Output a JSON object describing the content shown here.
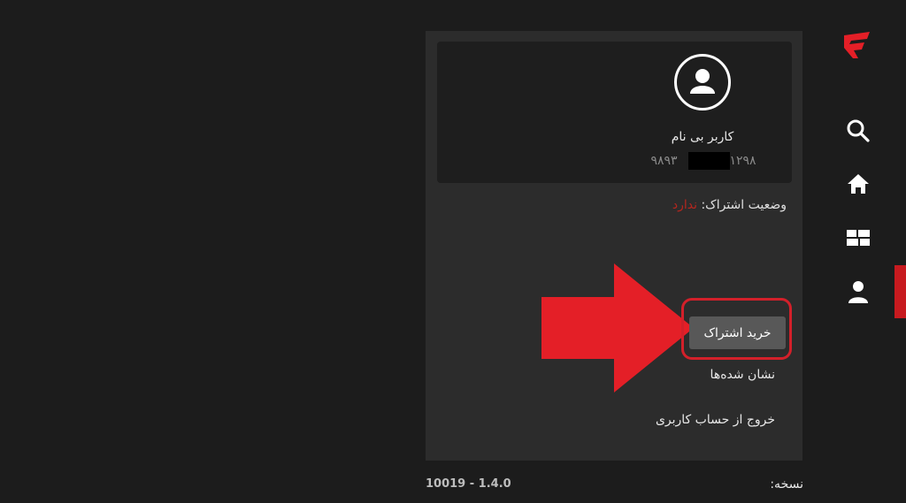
{
  "rail": {
    "logo": "filimo-logo",
    "items": [
      {
        "icon": "search-icon"
      },
      {
        "icon": "home-icon"
      },
      {
        "icon": "categories-icon"
      },
      {
        "icon": "user-icon",
        "active": true
      }
    ],
    "accent_color": "#c71a1f"
  },
  "profile": {
    "name": "کاربر بی نام",
    "phone_prefix": "۹۸۹۳",
    "phone_suffix": "۱۲۹۸",
    "avatar_icon": "user-avatar-icon"
  },
  "subscription": {
    "label": "وضعیت اشتراک:",
    "value": "ندارد",
    "value_color": "#b3261e"
  },
  "actions": {
    "buy_label": "خرید اشتراک",
    "bookmarks_label": "نشان شده‌ها",
    "logout_label": "خروج از حساب کاربری"
  },
  "version": {
    "label": "نسخه:",
    "value": "10019 - 1.4.0"
  },
  "annotation": {
    "arrow_color": "#e41f27",
    "highlight_color": "#d3202a"
  }
}
